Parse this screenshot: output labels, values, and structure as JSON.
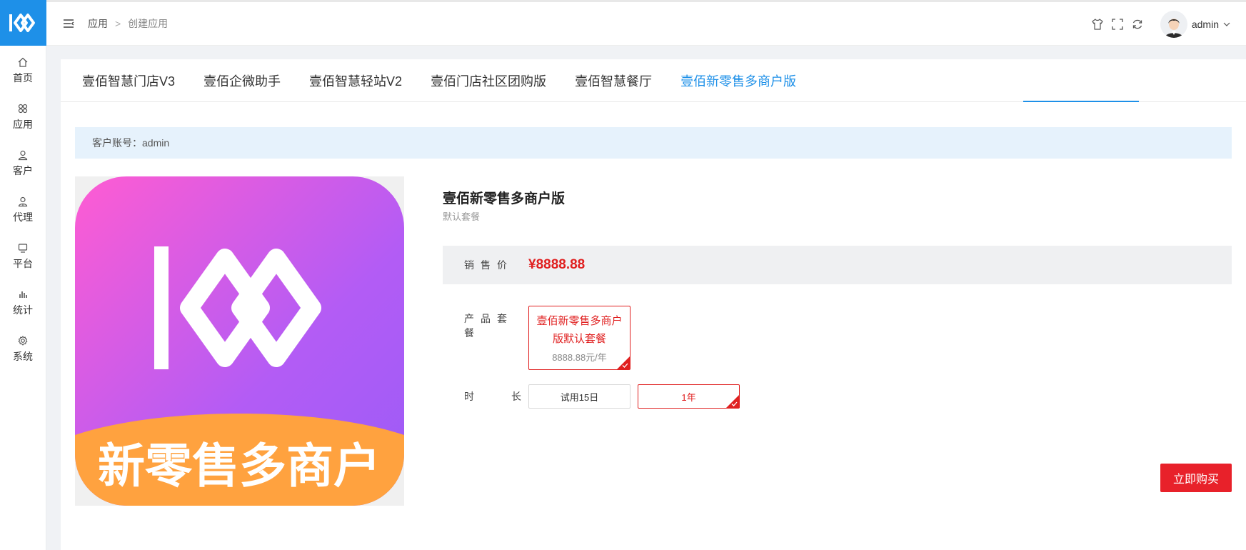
{
  "brand": {
    "accent": "#1e90e8",
    "price_color": "#e02020",
    "buy_color": "#e8212a"
  },
  "sidebar": {
    "items": [
      {
        "icon": "home-icon",
        "label": "首页"
      },
      {
        "icon": "apps-icon",
        "label": "应用"
      },
      {
        "icon": "user-icon",
        "label": "客户"
      },
      {
        "icon": "agent-icon",
        "label": "代理"
      },
      {
        "icon": "monitor-icon",
        "label": "平台"
      },
      {
        "icon": "bar-chart-icon",
        "label": "统计"
      },
      {
        "icon": "gear-icon",
        "label": "系统"
      }
    ]
  },
  "header": {
    "breadcrumb": {
      "parent": "应用",
      "separator": ">",
      "current": "创建应用"
    },
    "user": {
      "name": "admin"
    }
  },
  "tabs": [
    {
      "label": "壹佰智慧门店V3",
      "active": false
    },
    {
      "label": "壹佰企微助手",
      "active": false
    },
    {
      "label": "壹佰智慧轻站V2",
      "active": false
    },
    {
      "label": "壹佰门店社区团购版",
      "active": false
    },
    {
      "label": "壹佰智慧餐厅",
      "active": false
    },
    {
      "label": "壹佰新零售多商户版",
      "active": true
    }
  ],
  "account": {
    "text": "客户账号：admin"
  },
  "product": {
    "image_banner": "新零售多商户",
    "title": "壹佰新零售多商户版",
    "subtitle": "默认套餐",
    "price_label": "销售价",
    "price": "¥8888.88",
    "package_label": "产品套餐",
    "package": {
      "name": "壹佰新零售多商户版默认套餐",
      "price": "8888.88元/年",
      "selected": true
    },
    "duration_label_left": "时",
    "duration_label_right": "长",
    "durations": [
      {
        "label": "试用15日",
        "selected": false
      },
      {
        "label": "1年",
        "selected": true
      }
    ],
    "buy_label": "立即购买"
  }
}
